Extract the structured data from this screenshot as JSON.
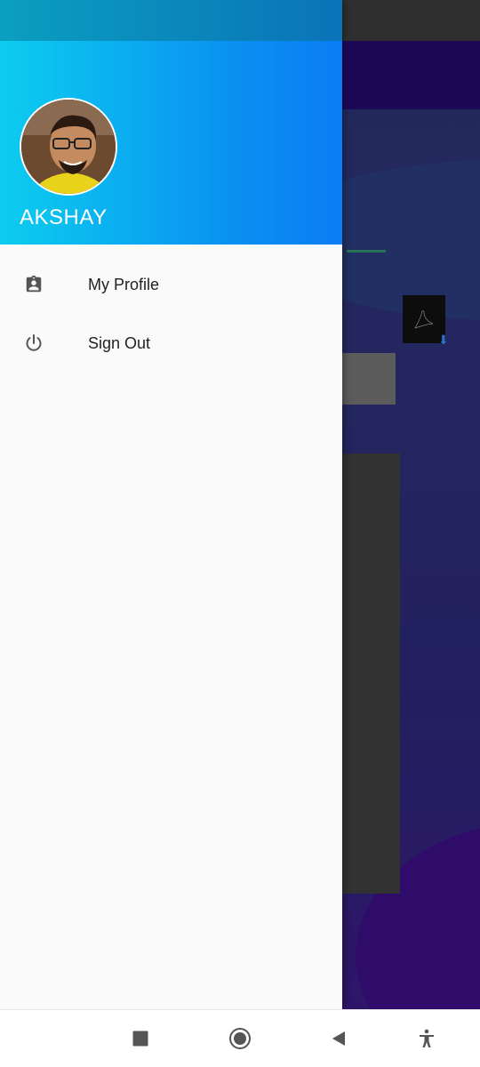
{
  "drawer": {
    "user_name": "AKSHAY",
    "menu": [
      {
        "label": "My Profile",
        "icon": "assignment-ind-icon"
      },
      {
        "label": "Sign Out",
        "icon": "power-icon"
      }
    ],
    "header_gradient": [
      "#0ccdef",
      "#0a7df5"
    ]
  },
  "navbar": {
    "buttons": [
      "recents-button",
      "home-button",
      "back-button",
      "accessibility-button"
    ]
  },
  "colors": {
    "drawer_bg": "#fafafa",
    "text": "#222222",
    "icon": "#555555"
  }
}
